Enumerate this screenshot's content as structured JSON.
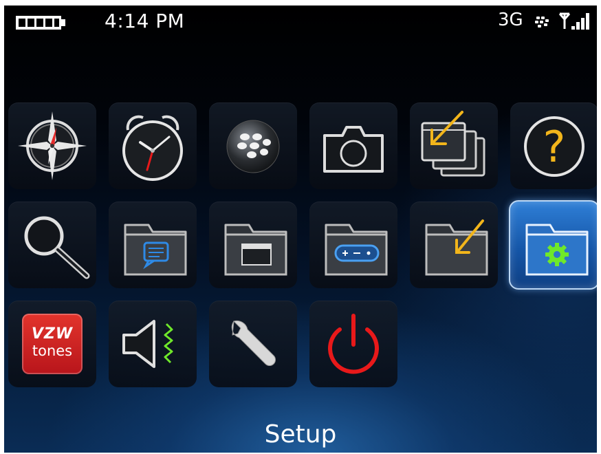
{
  "status_bar": {
    "time": "4:14 PM",
    "network": "3G",
    "icons": [
      "battery-icon",
      "blackberry-network-icon",
      "signal-strength-icon"
    ]
  },
  "apps": [
    {
      "name": "compass",
      "icon": "compass-icon"
    },
    {
      "name": "clock",
      "icon": "alarm-clock-icon"
    },
    {
      "name": "blackberry",
      "icon": "blackberry-logo-icon"
    },
    {
      "name": "camera",
      "icon": "camera-icon"
    },
    {
      "name": "downloads-windows",
      "icon": "download-windows-icon"
    },
    {
      "name": "help",
      "icon": "question-mark-icon"
    },
    {
      "name": "search",
      "icon": "magnifier-icon"
    },
    {
      "name": "messages-folder",
      "icon": "folder-message-icon"
    },
    {
      "name": "applications-folder",
      "icon": "folder-window-icon"
    },
    {
      "name": "games-folder",
      "icon": "folder-gamepad-icon"
    },
    {
      "name": "downloads-folder",
      "icon": "folder-download-icon"
    },
    {
      "name": "setup-folder",
      "icon": "folder-gear-icon",
      "selected": true
    },
    {
      "name": "vzw-tones",
      "icon": "vzw-tones-icon",
      "line1": "VZW",
      "line2": "tones"
    },
    {
      "name": "sound-profiles",
      "icon": "speaker-vibrate-icon"
    },
    {
      "name": "settings",
      "icon": "wrench-icon"
    },
    {
      "name": "power",
      "icon": "power-icon"
    }
  ],
  "selected_label": "Setup",
  "colors": {
    "accent_blue": "#2f7fd6",
    "power_red": "#e8191a",
    "help_yellow": "#f2b51b",
    "gear_green": "#6fe82a"
  }
}
